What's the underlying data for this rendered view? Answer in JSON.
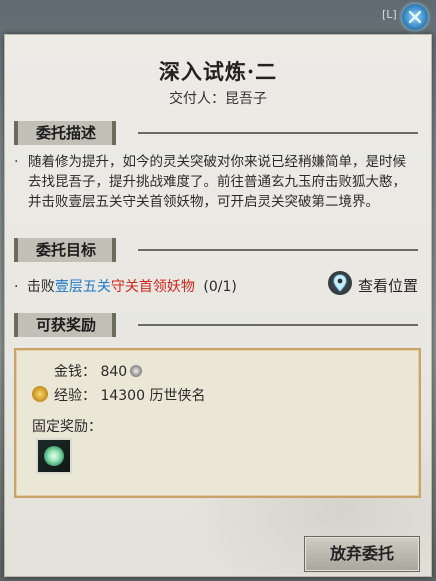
{
  "window": {
    "hotkey": "[L]",
    "close_icon": "close-x-icon"
  },
  "quest": {
    "title": "深入试炼·二",
    "giver": "交付人：昆吾子"
  },
  "sections": {
    "description_header": "委托描述",
    "target_header": "委托目标",
    "reward_header": "可获奖励"
  },
  "description": {
    "bullet": "·",
    "text": "随着修为提升，如今的灵关突破对你来说已经稍嫌简单，是时候去找昆吾子，提升挑战难度了。前往普通玄九玉府击败狐大憨，并击败壹层五关守关首领妖物，可开启灵关突破第二境界。"
  },
  "target": {
    "bullet": "·",
    "prefix": "击败",
    "location": "壹层五关",
    "boss": "守关首领妖物",
    "progress": "(0/1)",
    "view_location_label": "查看位置",
    "view_location_icon": "map-pin-icon"
  },
  "rewards": {
    "money_label": "金钱：",
    "money_value": "840",
    "money_icon": "silver-coin-icon",
    "exp_label": "经验：",
    "exp_value": "14300 历世侠名",
    "exp_icon": "experience-icon",
    "fixed_label": "固定奖励：",
    "fixed_item_icon": "jade-token-item-icon"
  },
  "actions": {
    "abandon_label": "放弃委托"
  },
  "colors": {
    "accent_blue": "#1e78c8",
    "accent_red": "#d0261e",
    "reward_border": "#c9a46a"
  }
}
